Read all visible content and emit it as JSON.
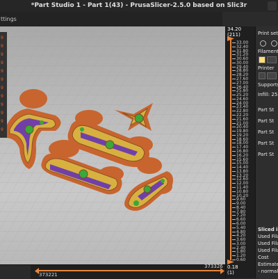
{
  "window": {
    "title": "*Part Studio 1 - Part 1(43) - PrusaSlicer-2.5.0 based on Slic3r"
  },
  "toolbar": {
    "tab_label": "ttings"
  },
  "legend": {
    "values": [
      "9",
      "9",
      "9",
      "9",
      "9",
      "9",
      "9",
      "9",
      "9",
      "9",
      "9",
      "9"
    ]
  },
  "vertical_slider": {
    "top_value": "34.20",
    "top_layer": "(211)",
    "labels": [
      "33.00",
      "32.40",
      "31.80",
      "31.20",
      "30.60",
      "30.00",
      "29.40",
      "28.80",
      "28.20",
      "27.60",
      "27.00",
      "26.40",
      "25.80",
      "25.20",
      "24.60",
      "24.00",
      "23.40",
      "22.80",
      "22.20",
      "21.60",
      "21.00",
      "20.40",
      "19.80",
      "19.20",
      "18.60",
      "18.00",
      "17.40",
      "16.80",
      "16.20",
      "15.60",
      "15.00",
      "14.40",
      "13.80",
      "13.20",
      "12.60",
      "12.00",
      "11.40",
      "10.80",
      "10.20",
      "9.60",
      "9.00",
      "8.40",
      "7.80",
      "7.20",
      "6.60",
      "6.00",
      "5.40",
      "4.80",
      "4.20",
      "3.60",
      "3.00",
      "2.40",
      "1.80",
      "1.20",
      "0.60"
    ],
    "bottom_value": "0.18",
    "bottom_layer": "(1)"
  },
  "horizontal_slider": {
    "left_value": "373221",
    "right_value": "373326"
  },
  "right_panel": {
    "print_settings_label": "Print setti",
    "filament_label": "Filament",
    "printer_label": "Printer",
    "supports_label": "Supports",
    "infill_label": "Infill:",
    "infill_value": "25",
    "objects": [
      "Part St",
      "Part St",
      "Part St",
      "Part St",
      "Part St"
    ],
    "sliced_info_header": "Sliced inf",
    "used_filament_1": "Used Filan",
    "used_filament_2": "Used Filan",
    "used_filament_3": "Used Filan",
    "cost_label": "Cost",
    "estimated_label": "Estimated",
    "normal_label": "- normal"
  },
  "colors": {
    "orange": "#e8863a",
    "part_orange": "#c8642e",
    "infill_purple": "#7040a8",
    "wipe_green": "#3aa83a",
    "perimeter_yellow": "#d8b040"
  }
}
